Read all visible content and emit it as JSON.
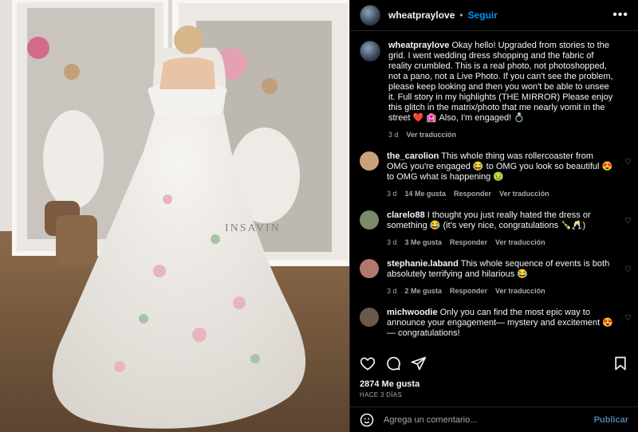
{
  "post": {
    "username": "wheatpraylove",
    "follow_label": "Seguir",
    "separator": "•",
    "more_label": "•••"
  },
  "caption": {
    "username": "wheatpraylove",
    "text": "Okay hello! Upgraded from stories to the grid. I went wedding dress shopping and the fabric of reality crumbled. This is a real photo, not photoshopped, not a pano, not a Live Photo. If you can't see the problem, please keep looking and then you won't be able to unsee it. Full story in my highlights (THE MIRROR) Please enjoy this glitch in the matrix/photo that me nearly vomit in the street ❤️ 🏩 Also, I'm engaged! 💍",
    "age": "3 d",
    "translate": "Ver traducción"
  },
  "comments": [
    {
      "username": "the_carolion",
      "text": "This whole thing was rollercoaster from OMG you're engaged 😂 to OMG you look so beautiful 😍 to OMG what is happening 🤢",
      "age": "3 d",
      "likes": "14 Me gusta",
      "reply": "Responder",
      "translate": "Ver traducción",
      "color": "#c9a27a"
    },
    {
      "username": "clarelo88",
      "text": "I thought you just really hated the dress or something 😂 (it's very nice, congratulations 🍾🥂)",
      "age": "3 d",
      "likes": "3 Me gusta",
      "reply": "Responder",
      "translate": "Ver traducción",
      "color": "#7a8a6a"
    },
    {
      "username": "stephanie.laband",
      "text": "This whole sequence of events is both absolutely terrifying and hilarious 😂",
      "age": "3 d",
      "likes": "2 Me gusta",
      "reply": "Responder",
      "translate": "Ver traducción",
      "color": "#b07a6a"
    },
    {
      "username": "michwoodie",
      "text": "Only you can find the most epic way to announce your engagement— mystery and excitement 😍 — congratulations!",
      "color": "#6a5a4a"
    }
  ],
  "icons": {
    "like": "heart-icon",
    "comment": "comment-icon",
    "share": "send-icon",
    "save": "bookmark-icon"
  },
  "likes_count": "2874 Me gusta",
  "posted_ago": "HACE 3 DÍAS",
  "comment_box": {
    "placeholder": "Agrega un comentario...",
    "publish": "Publicar"
  },
  "photo": {
    "watermark": "INSAVIN"
  },
  "colors": {
    "accent": "#0095f6",
    "publish": "#4b7dac",
    "secondary_text": "#a8a8a8"
  }
}
